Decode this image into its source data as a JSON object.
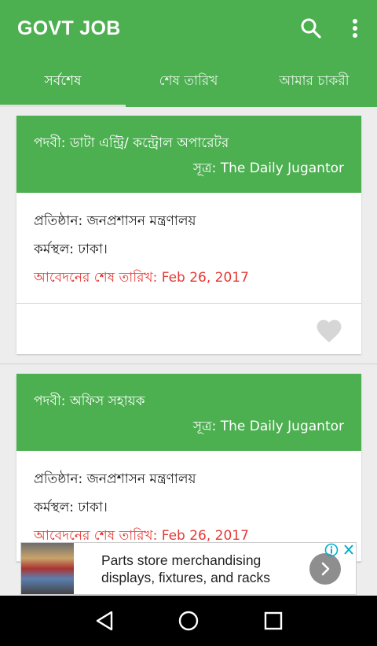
{
  "app": {
    "title": "GOVT JOB"
  },
  "tabs": [
    {
      "label": "সর্বশেষ"
    },
    {
      "label": "শেষ তারিখ"
    },
    {
      "label": "আমার চাকরী"
    }
  ],
  "jobs": [
    {
      "title": "পদবী: ডাটা এন্ট্রি/ কন্ট্রোল অপারেটর",
      "source": "সূত্র: The Daily Jugantor",
      "organization": "প্রতিষ্ঠান: জনপ্রশাসন মন্ত্রণালয়",
      "location": "কর্মস্থল: ঢাকা।",
      "deadline": "আবেদনের শেষ তারিখ: Feb 26, 2017"
    },
    {
      "title": "পদবী: অফিস সহায়ক",
      "source": "সূত্র: The Daily Jugantor",
      "organization": "প্রতিষ্ঠান: জনপ্রশাসন মন্ত্রণালয়",
      "location": "কর্মস্থল: ঢাকা।",
      "deadline": "আবেদনের শেষ তারিখ: Feb 26, 2017"
    }
  ],
  "ad": {
    "line1": "Parts store merchandising",
    "line2": "displays, fixtures, and racks"
  },
  "icons": {
    "search": "search-icon",
    "more": "more-vert-icon",
    "favorite": "heart-icon",
    "ad_arrow": "chevron-right-icon",
    "ad_info": "info-icon",
    "ad_close": "close-icon",
    "nav_back": "back-triangle-icon",
    "nav_home": "home-circle-icon",
    "nav_recent": "recent-square-icon"
  },
  "colors": {
    "primary": "#4caf50",
    "deadline": "#e53935",
    "favorite_inactive": "#d6d6d6"
  }
}
